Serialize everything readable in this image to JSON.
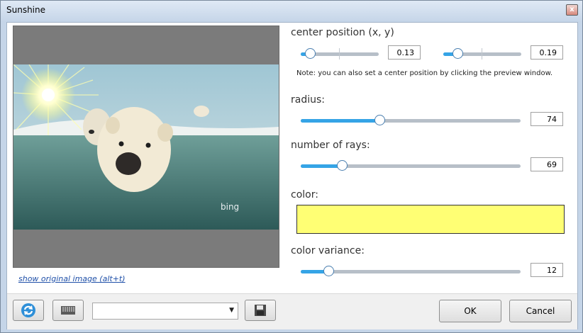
{
  "window": {
    "title": "Sunshine",
    "close_glyph": "x"
  },
  "preview": {
    "watermark": "bing",
    "show_original_link": "show original image (alt+t)"
  },
  "center_position": {
    "label": "center position (x, y)",
    "x": {
      "value": "0.13",
      "fraction": 0.13
    },
    "y": {
      "value": "0.19",
      "fraction": 0.19
    },
    "note": "Note: you can also set a center position by clicking the preview window."
  },
  "radius": {
    "label": "radius:",
    "value": "74",
    "fraction": 0.36
  },
  "rays": {
    "label": "number of rays:",
    "value": "69",
    "fraction": 0.19
  },
  "color": {
    "label": "color:",
    "hex": "#ffff74"
  },
  "variance": {
    "label": "color variance:",
    "value": "12",
    "fraction": 0.13
  },
  "footer": {
    "preset_value": "",
    "ok_label": "OK",
    "cancel_label": "Cancel",
    "refresh_icon": "refresh-icon",
    "ruler_icon": "ruler-icon",
    "save_icon": "floppy-disk-icon"
  }
}
